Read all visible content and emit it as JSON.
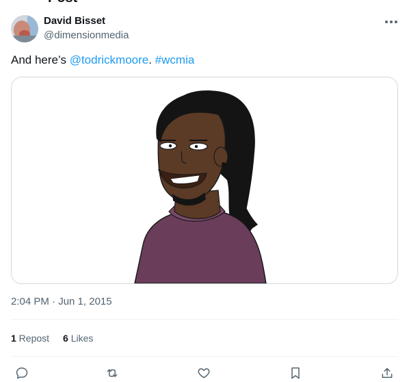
{
  "page": {
    "title": "Post"
  },
  "author": {
    "name": "David Bisset",
    "handle": "@dimensionmedia",
    "avatar_icon": "user-avatar"
  },
  "tweet": {
    "text_prefix": "And here’s ",
    "mention": "@todrickmoore",
    "separator": ". ",
    "hashtag": "#wcmia",
    "media_description": "cartoon-portrait"
  },
  "meta": {
    "timestamp": "2:04 PM · Jun 1, 2015"
  },
  "stats": {
    "reposts_count": "1",
    "reposts_label": " Repost",
    "likes_count": "6",
    "likes_label": " Likes"
  },
  "actions": [
    "reply-icon",
    "repost-icon",
    "like-icon",
    "bookmark-icon",
    "share-icon"
  ],
  "colors": {
    "link": "#1d9bf0",
    "muted": "#536471",
    "text": "#0f1419",
    "divider": "#eff3f4"
  }
}
